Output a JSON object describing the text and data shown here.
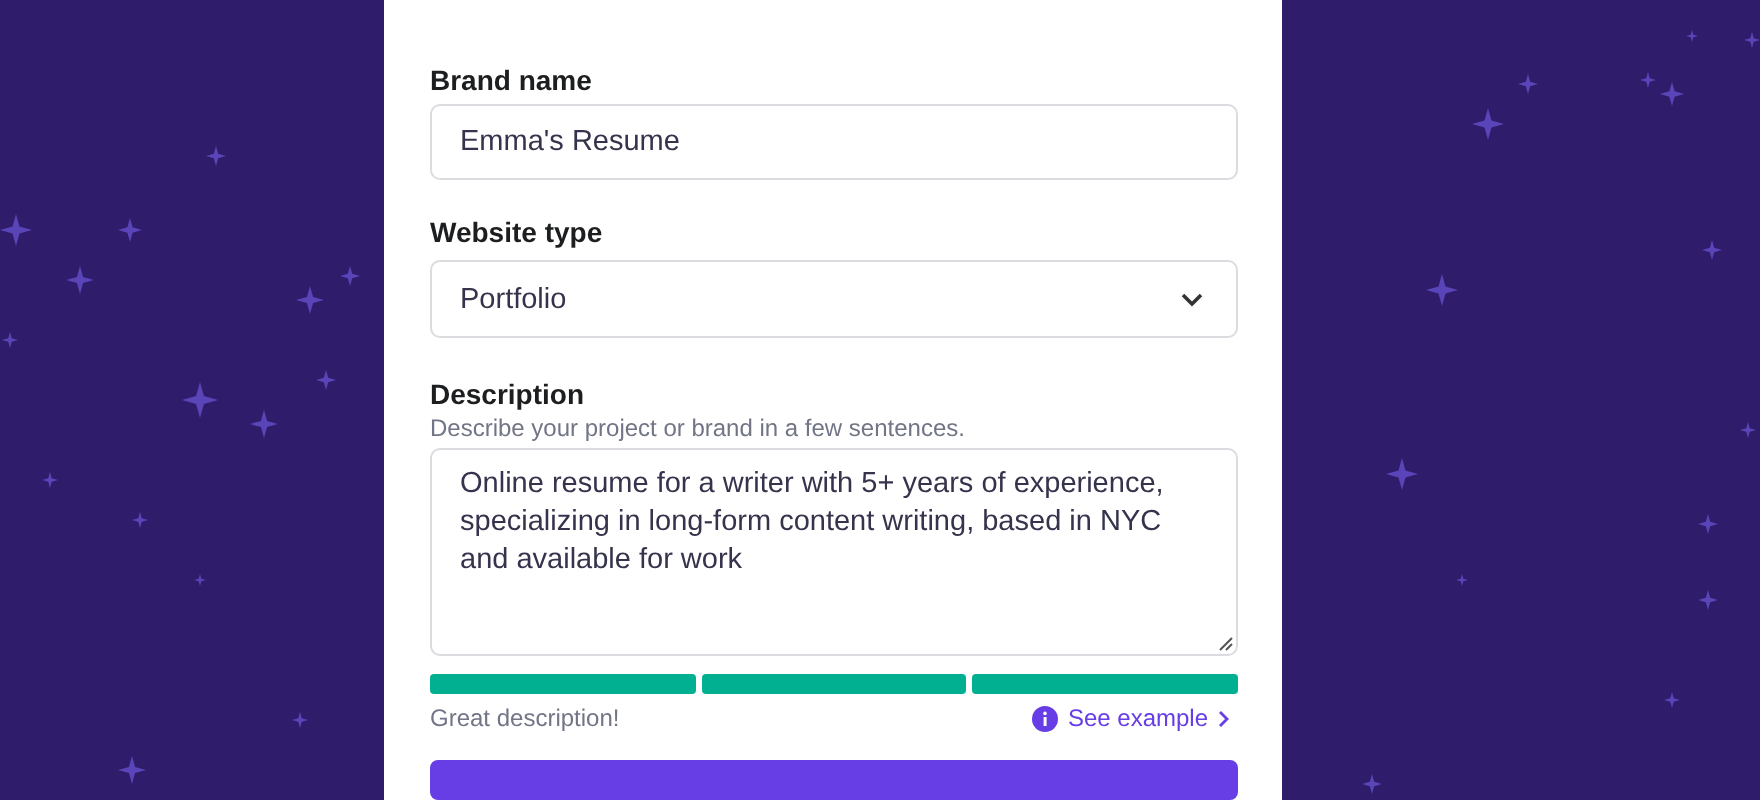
{
  "brand_name": {
    "label": "Brand name",
    "value": "Emma's Resume"
  },
  "website_type": {
    "label": "Website type",
    "value": "Portfolio"
  },
  "description": {
    "label": "Description",
    "hint": "Describe your project or brand in a few sentences.",
    "value": "Online resume for a writer with 5+ years of experience, specializing in long-form content writing, based in NYC and available for work",
    "strength": [
      {
        "filled": true
      },
      {
        "filled": true
      },
      {
        "filled": true
      }
    ],
    "feedback": "Great description!",
    "link": "See example"
  }
}
